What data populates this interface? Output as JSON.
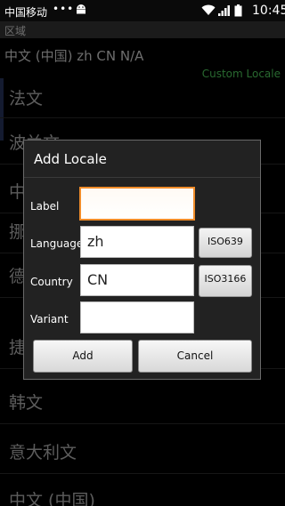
{
  "status_bar": {
    "carrier": "中国移动",
    "notifications": "•••",
    "time": "10:45"
  },
  "title_bar": {
    "title": "区域"
  },
  "current_locale": "中文 (中国)  zh CN N/A",
  "custom_locale_label": "Custom Locale",
  "languages": [
    "法文",
    "波兰文",
    "中文 (台湾)",
    "挪威文",
    "德文",
    "捷克文",
    "韩文",
    "意大利文",
    "中文 (中国)"
  ],
  "dialog": {
    "title": "Add Locale",
    "label_field": {
      "label": "Label",
      "value": ""
    },
    "language_field": {
      "label": "Language",
      "value": "zh"
    },
    "country_field": {
      "label": "Country",
      "value": "CN"
    },
    "variant_field": {
      "label": "Variant",
      "value": ""
    },
    "iso639_button": "ISO639",
    "iso3166_button": "ISO3166",
    "add_button": "Add",
    "cancel_button": "Cancel"
  },
  "colors": {
    "accent_green": "#3fa24b",
    "focus_orange": "#f08c2a",
    "dialog_bg": "#222222"
  }
}
